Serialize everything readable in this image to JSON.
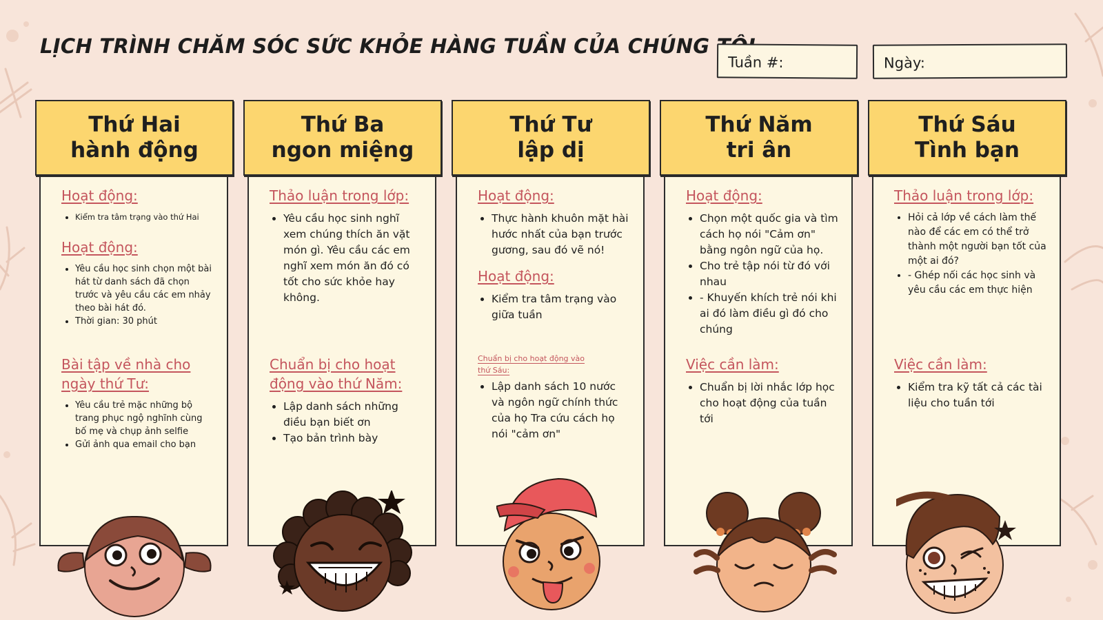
{
  "page": {
    "title": "LỊCH TRÌNH CHĂM SÓC SỨC KHỎE HÀNG TUẦN CỦA CHÚNG TÔI",
    "week_label": "Tuần #:",
    "date_label": "Ngày:"
  },
  "colors": {
    "background": "#f8e5da",
    "header": "#fcd66f",
    "card": "#fdf7e2",
    "heading": "#c4555d"
  },
  "days": [
    {
      "line1": "Thứ Hai",
      "line2": "hành động",
      "face": "girl-pigtails-smiling",
      "sections": [
        {
          "heading": "Hoạt động:",
          "items": [
            "Kiểm tra tâm trạng vào thứ Hai"
          ]
        },
        {
          "heading": "Hoạt động:",
          "items": [
            "Yêu cầu học sinh chọn một bài hát từ danh sách đã chọn trước và yêu cầu các em nhảy theo bài hát đó.",
            "Thời gian: 30 phút"
          ]
        },
        {
          "heading": "Bài tập về nhà cho ngày thứ Tư:",
          "items": [
            "Yêu cầu trẻ mặc những bộ trang phục ngộ nghĩnh cùng bố mẹ và chụp ảnh selfie",
            "Gửi ảnh qua email cho bạn"
          ]
        }
      ]
    },
    {
      "line1": "Thứ Ba",
      "line2": "ngon miệng",
      "face": "curly-hair-laughing",
      "sections": [
        {
          "heading": "Thảo luận trong lớp:",
          "items": [
            "Yêu cầu học sinh nghĩ xem chúng thích ăn vặt món gì. Yêu cầu các em nghĩ xem món ăn đó có tốt cho sức khỏe hay không."
          ]
        },
        {
          "heading": "Chuẩn bị cho hoạt động vào thứ Năm:",
          "items": [
            "Lập danh sách những điều bạn biết ơn",
            "Tạo bản trình bày"
          ]
        }
      ]
    },
    {
      "line1": "Thứ Tư",
      "line2": "lập dị",
      "face": "cap-tongue-out",
      "sections": [
        {
          "heading": "Hoạt động:",
          "items": [
            "Thực hành khuôn mặt hài hước nhất của bạn trước gương, sau đó vẽ nó!"
          ]
        },
        {
          "heading": "Hoạt động:",
          "items": [
            "Kiểm tra tâm trạng vào giữa tuần"
          ]
        },
        {
          "heading": "Chuẩn bị cho hoạt động vào thứ Sáu:",
          "items": [
            "Lập danh sách 10 nước và ngôn ngữ chính thức của họ Tra cứu cách họ nói \"cảm ơn\""
          ]
        }
      ]
    },
    {
      "line1": "Thứ Năm",
      "line2": "tri ân",
      "face": "buns-calm",
      "sections": [
        {
          "heading": "Hoạt động:",
          "items": [
            "Chọn một quốc gia và tìm cách họ nói \"Cảm ơn\" bằng ngôn ngữ của họ.",
            "Cho trẻ tập nói từ đó với nhau",
            "- Khuyến khích trẻ nói khi ai đó làm điều gì đó cho chúng"
          ]
        },
        {
          "heading": "Việc cần làm:",
          "items": [
            "Chuẩn bị lời nhắc lớp học cho hoạt động của tuần tới"
          ]
        }
      ]
    },
    {
      "line1": "Thứ Sáu",
      "line2": "Tình bạn",
      "face": "boy-winking",
      "sections": [
        {
          "heading": "Thảo luận trong lớp:",
          "items": [
            "Hỏi cả lớp về cách làm thế nào để các em có thể trở thành một người bạn tốt của một ai đó?",
            "- Ghép nối các học sinh và yêu cầu các em thực hiện"
          ]
        },
        {
          "heading": "Việc cần làm:",
          "items": [
            "Kiểm tra kỹ tất cả các tài liệu cho tuần tới"
          ]
        }
      ]
    }
  ]
}
